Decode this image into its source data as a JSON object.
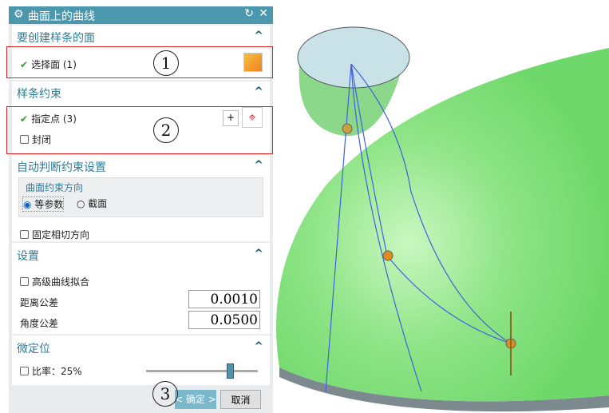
{
  "dialog": {
    "title": "曲面上的曲线",
    "settings_icon": "gear-icon",
    "reset_icon": "reset-icon",
    "close_icon": "close-icon"
  },
  "sections": {
    "face": {
      "title": "要创建样条的面",
      "select_face": "选择面 (1)"
    },
    "constraint": {
      "title": "样条约束",
      "specify_points": "指定点 (3)",
      "closed": "封闭"
    },
    "auto": {
      "title": "自动判断约束设置",
      "group_title": "曲面约束方向",
      "opt_iso": "等参数",
      "opt_section": "截面",
      "fix_tangent": "固定相切方向"
    },
    "settings": {
      "title": "设置",
      "advanced_fit": "高级曲线拟合",
      "dist_tol_label": "距离公差",
      "dist_tol": "0.0010",
      "angle_tol_label": "角度公差",
      "angle_tol": "0.0500"
    },
    "micro": {
      "title": "微定位",
      "ratio_label": "比率：25%",
      "slider_fraction": 0.75
    }
  },
  "buttons": {
    "ok": "< 确定 >",
    "cancel": "取消"
  },
  "annotations": {
    "c1": "1",
    "c2": "2",
    "c3": "3"
  },
  "colors": {
    "title": "#4b97ad",
    "accent": "#2f7c98",
    "face": "#7de07a",
    "highlight": "#e02020"
  }
}
